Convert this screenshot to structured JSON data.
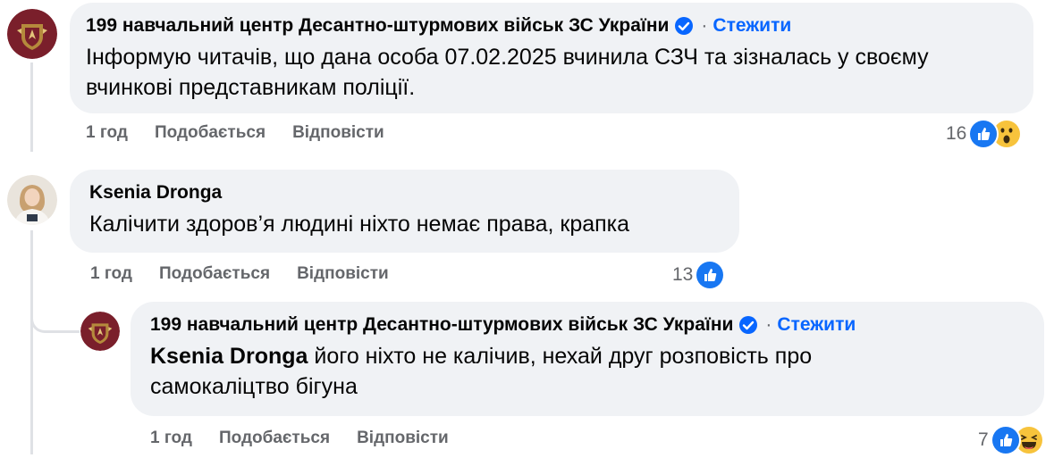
{
  "comments": [
    {
      "author": "199 навчальний центр Десантно-штурмових військ ЗС України",
      "follow_label": "Стежити",
      "separator": "·",
      "text": "Інформую читачів, що дана особа 07.02.2025 вчинила СЗЧ та зізналась у своєму вчинкові представникам поліції.",
      "time": "1 год",
      "like_label": "Подобається",
      "reply_label": "Відповісти",
      "reaction_count": "16",
      "reactions": [
        "like-icon",
        "wow-icon"
      ]
    },
    {
      "author": "Ksenia Dronga",
      "text": "Калічити здоров’я людині ніхто немає права, крапка",
      "time": "1 год",
      "like_label": "Подобається",
      "reply_label": "Відповісти",
      "reaction_count": "13",
      "reactions": [
        "like-icon"
      ]
    },
    {
      "author": "199 навчальний центр Десантно-штурмових військ ЗС України",
      "follow_label": "Стежити",
      "separator": "·",
      "mention": "Ksenia Dronga",
      "text": " його ніхто не калічив, нехай друг розповість про самокаліцтво бігуна",
      "time": "1 год",
      "like_label": "Подобається",
      "reply_label": "Відповісти",
      "reaction_count": "7",
      "reactions": [
        "like-icon",
        "haha-icon"
      ]
    }
  ],
  "colors": {
    "bubble": "#f0f2f5",
    "link_blue": "#0866ff",
    "meta_gray": "#65676b",
    "thread_line": "#dfe1e5",
    "avatar_maroon": "#7a1f2b",
    "reaction_yellow": "#f7c33c"
  }
}
